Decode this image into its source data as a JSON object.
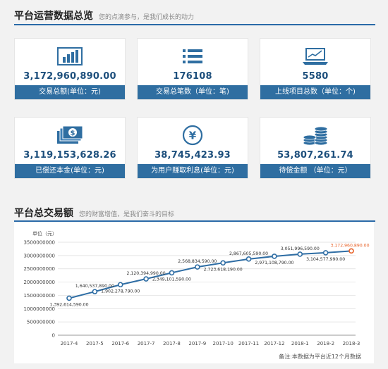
{
  "overview": {
    "title": "平台运营数据总览",
    "subtitle": "您的点滴参与，是我们成长的动力"
  },
  "cards": [
    {
      "icon": "bar-chart-icon",
      "value": "3,172,960,890.00",
      "label": "交易总额(单位：元)"
    },
    {
      "icon": "list-icon",
      "value": "176108",
      "label": "交易总笔数（单位：笔)"
    },
    {
      "icon": "laptop-chart-icon",
      "value": "5580",
      "label": "上线项目总数（单位：个)"
    },
    {
      "icon": "money-stack-icon",
      "value": "3,119,153,628.26",
      "label": "已偿还本金(单位：元)"
    },
    {
      "icon": "yen-icon",
      "value": "38,745,423.93",
      "label": "为用户赚取利息(单位：元)"
    },
    {
      "icon": "coins-icon",
      "value": "53,807,261.74",
      "label": "待偿金额 （单位：元）"
    }
  ],
  "trade": {
    "title": "平台总交易额",
    "subtitle": "您的财富增值，是我们奋斗的目标"
  },
  "chart_data": {
    "type": "line",
    "ylabel": "单位（元）",
    "categories": [
      "2017-4",
      "2017-5",
      "2017-6",
      "2017-7",
      "2017-8",
      "2017-9",
      "2017-10",
      "2017-11",
      "2017-12",
      "2018-1",
      "2018-2",
      "2018-3"
    ],
    "values": [
      1392614590,
      1640537890,
      1902278790,
      2120394990,
      2349101590,
      2568834590,
      2723618190,
      2867605590,
      2971108790,
      3051996590,
      3104577990,
      3172960890
    ],
    "data_labels": [
      "1,392,614,590.00",
      "1,640,537,890.00",
      "1,902,278,790.00",
      "2,120,394,990.00",
      "2,349,101,590.00",
      "2,568,834,590.00",
      "2,723,618,190.00",
      "2,867,605,590.00",
      "2,971,108,790.00",
      "3,051,996,590.00",
      "3,104,577,990.00",
      "3,172,960,890.00"
    ],
    "label_above": [
      false,
      true,
      false,
      true,
      false,
      true,
      false,
      true,
      false,
      true,
      false,
      true
    ],
    "yticks": [
      "0",
      "500000000",
      "1000000000",
      "1500000000",
      "2000000000",
      "2500000000",
      "3000000000",
      "3500000000"
    ],
    "ylim": [
      0,
      3500000000
    ],
    "grid": true,
    "line_color": "#2e6da4",
    "highlight_color": "#e8632a"
  },
  "footnote": "备注:本数据为平台近12个月数据"
}
